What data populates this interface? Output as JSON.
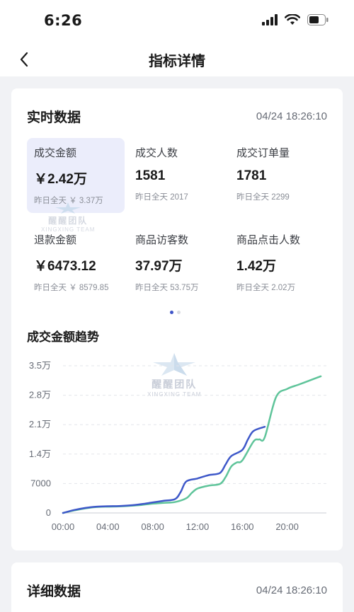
{
  "status_bar": {
    "time": "6:26",
    "icons": [
      "signal-icon",
      "wifi-icon",
      "battery-icon"
    ]
  },
  "nav": {
    "title": "指标详情",
    "back_icon": "chevron-left-icon"
  },
  "realtime": {
    "title": "实时数据",
    "timestamp": "04/24 18:26:10",
    "metrics": [
      {
        "label": "成交金额",
        "value": "￥2.42万",
        "sub": "昨日全天 ￥ 3.37万",
        "selected": true
      },
      {
        "label": "成交人数",
        "value": "1581",
        "sub": "昨日全天 2017"
      },
      {
        "label": "成交订单量",
        "value": "1781",
        "sub": "昨日全天 2299"
      },
      {
        "label": "退款金额",
        "value": "￥6473.12",
        "sub": "昨日全天 ￥ 8579.85"
      },
      {
        "label": "商品访客数",
        "value": "37.97万",
        "sub": "昨日全天 53.75万"
      },
      {
        "label": "商品点击人数",
        "value": "1.42万",
        "sub": "昨日全天 2.02万"
      }
    ],
    "pagination": {
      "pages": 2,
      "current": 1
    }
  },
  "watermark": {
    "text": "醒醒团队",
    "sub": "XINGXING TEAM"
  },
  "trend": {
    "title": "成交金额趋势",
    "colors": {
      "today": "#3e58c9",
      "yesterday": "#5fc49a",
      "grid": "#e3e5ea",
      "axis": "#c9ccd3"
    }
  },
  "chart_data": {
    "type": "line",
    "x_tick_labels": [
      "00:00",
      "04:00",
      "08:00",
      "12:00",
      "16:00",
      "20:00"
    ],
    "y_tick_labels": [
      "0",
      "7000",
      "1.4万",
      "2.1万",
      "2.8万",
      "3.5万"
    ],
    "xlim": [
      0,
      23.5
    ],
    "ylim": [
      0,
      35000
    ],
    "grid": true,
    "series": [
      {
        "color": "#5fc49a",
        "x": [
          0,
          1,
          2,
          3,
          4,
          5,
          6,
          7,
          8,
          9,
          10,
          11,
          11.5,
          12,
          13,
          14,
          14.5,
          15,
          15.5,
          16,
          17,
          17.5,
          18,
          19,
          20,
          21,
          22,
          23
        ],
        "y": [
          0,
          600,
          1100,
          1400,
          1500,
          1550,
          1700,
          1900,
          2200,
          2400,
          2600,
          3500,
          4800,
          5800,
          6500,
          6900,
          8500,
          11000,
          12000,
          12500,
          17000,
          17500,
          18000,
          27500,
          29500,
          30500,
          31500,
          32500
        ]
      },
      {
        "color": "#3e58c9",
        "x": [
          0,
          1,
          2,
          3,
          4,
          5,
          6,
          7,
          8,
          9,
          10,
          10.5,
          11,
          12,
          13,
          14,
          14.5,
          15,
          16,
          16.5,
          17,
          18
        ],
        "y": [
          0,
          700,
          1200,
          1500,
          1600,
          1650,
          1800,
          2100,
          2500,
          2900,
          3300,
          5000,
          7500,
          8200,
          9000,
          9500,
          11500,
          13500,
          15000,
          17500,
          19500,
          20500
        ]
      }
    ]
  },
  "detail": {
    "title": "详细数据",
    "timestamp": "04/24 18:26:10"
  }
}
